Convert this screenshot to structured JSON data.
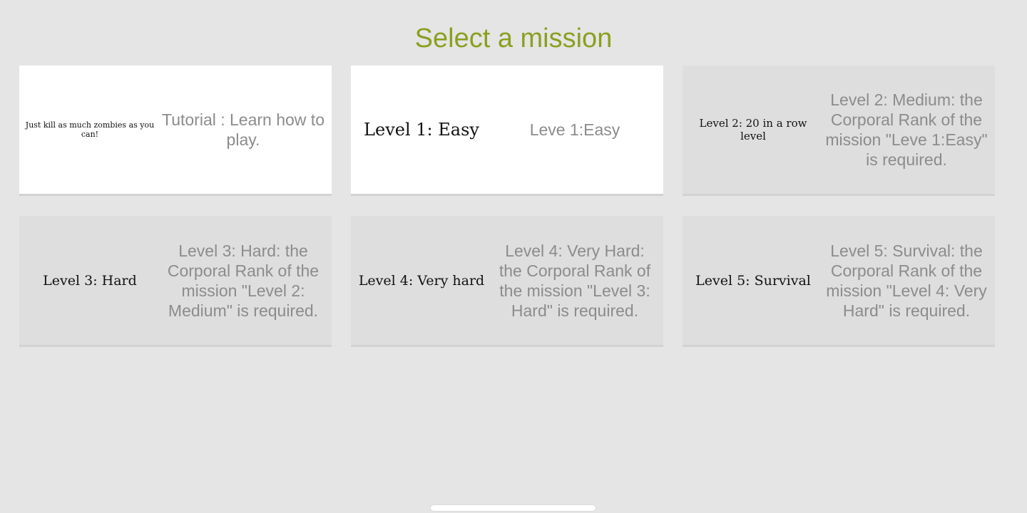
{
  "header": {
    "title": "Select a mission"
  },
  "colors": {
    "title": "#8aa01f",
    "background": "#e5e5e5",
    "card_unlocked": "#ffffff",
    "card_locked": "#dedede",
    "description_text": "#8c8c8c"
  },
  "missions": [
    {
      "name": "Just kill as much zombies as you can!",
      "description": "Tutorial : Learn how to play.",
      "locked": false
    },
    {
      "name": "Level 1: Easy",
      "description": "Leve 1:Easy",
      "locked": false
    },
    {
      "name": "Level 2: 20 in a row level",
      "description": "Level 2: Medium: the Corporal Rank of the mission \"Leve 1:Easy\" is required.",
      "locked": true
    },
    {
      "name": "Level 3: Hard",
      "description": "Level 3: Hard: the Corporal Rank of the mission \"Level 2: Medium\" is required.",
      "locked": true
    },
    {
      "name": "Level 4: Very hard",
      "description": "Level 4: Very Hard: the Corporal Rank of the mission \"Level 3: Hard\" is required.",
      "locked": true
    },
    {
      "name": "Level 5: Survival",
      "description": "Level 5: Survival: the Corporal Rank of the mission \"Level 4: Very Hard\" is required.",
      "locked": true
    }
  ]
}
